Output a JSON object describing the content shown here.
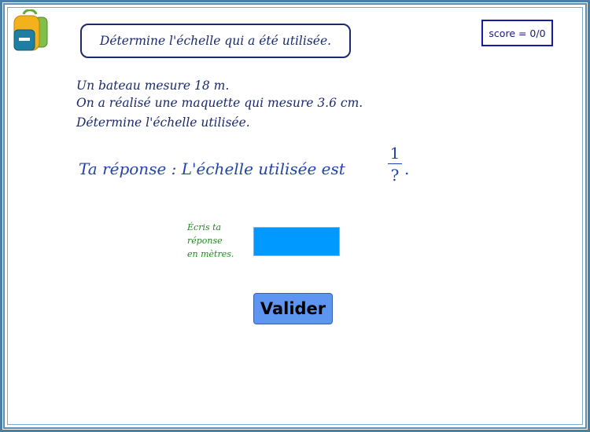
{
  "header": {
    "title": "Détermine l'échelle qui a été utilisée.",
    "score": "score = 0/0",
    "app_icon": "backpack-icon"
  },
  "problem": {
    "line1": "Un bateau mesure 18 m.",
    "line2": "On a réalisé une maquette qui mesure 3.6 cm.",
    "line3": "Détermine l'échelle utilisée."
  },
  "answer": {
    "prefix": "Ta réponse :  L'échelle utilisée est",
    "numerator": "1",
    "denominator": "?",
    "suffix": "."
  },
  "input": {
    "hint_line1": "Écris ta",
    "hint_line2": "réponse",
    "hint_line3": "en mètres.",
    "value": ""
  },
  "actions": {
    "validate_label": "Valider"
  },
  "colors": {
    "frame": "#4a7fa8",
    "title_text": "#1a2a6c",
    "answer_text": "#2244aa",
    "hint_text": "#1d8a1d",
    "input_background": "#0099ff",
    "button_background": "#5e95f1"
  }
}
